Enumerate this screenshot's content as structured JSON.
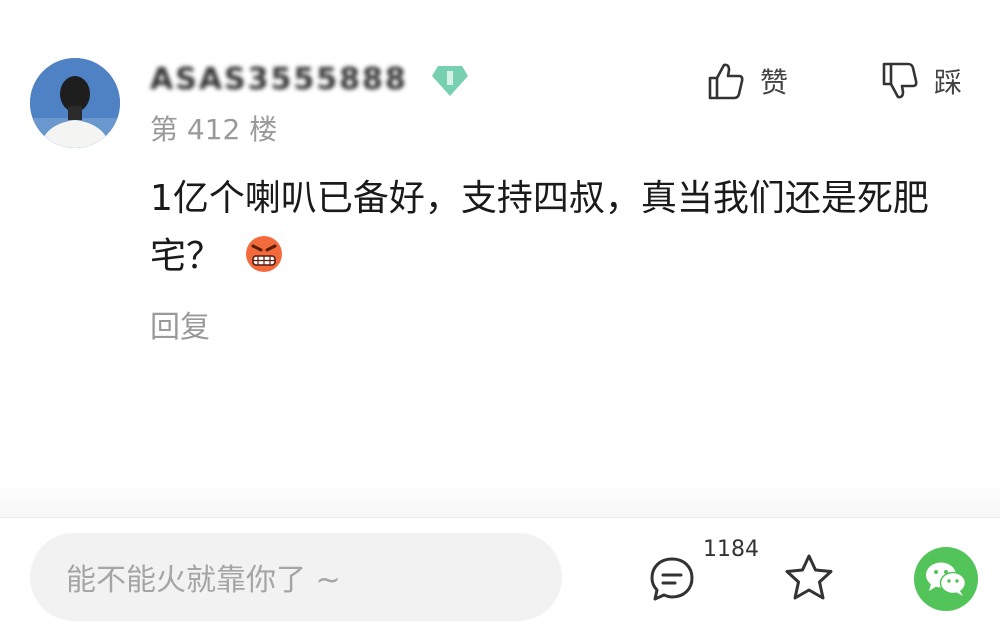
{
  "comment": {
    "username": "ASAS3555888",
    "floor": "第 412 楼",
    "like_label": "赞",
    "dislike_label": "踩",
    "text": "1亿个喇叭已备好，支持四叔，真当我们还是死肥宅？",
    "reply_label": "回复"
  },
  "bottom_bar": {
    "input_placeholder": "能不能火就靠你了 ~",
    "comment_count": "1184"
  },
  "colors": {
    "wechat_green": "#53c45a",
    "badge_green": "#5fc9a3",
    "secondary_text": "#9a9a9a"
  },
  "icons": {
    "like": "thumbs-up-icon",
    "dislike": "thumbs-down-icon",
    "comment": "chat-bubble-icon",
    "favorite": "star-icon",
    "share": "wechat-icon",
    "emoji": "angry-face-emoji"
  }
}
